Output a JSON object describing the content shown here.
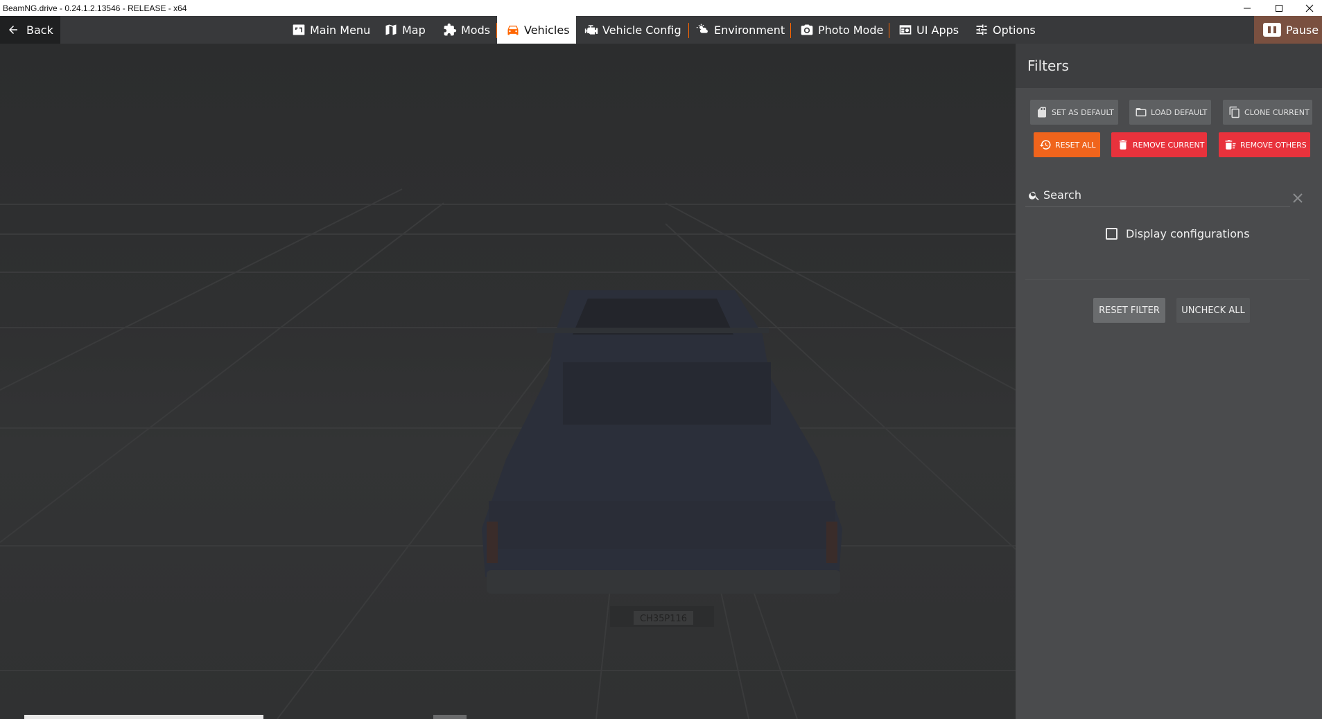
{
  "window": {
    "title": "BeamNG.drive - 0.24.1.2.13546 - RELEASE - x64"
  },
  "nav": {
    "back_label": "Back",
    "items": [
      {
        "label": "Main Menu",
        "icon": "main-menu-icon"
      },
      {
        "label": "Map",
        "icon": "map-icon"
      },
      {
        "label": "Mods",
        "icon": "puzzle-icon"
      },
      {
        "label": "Vehicles",
        "icon": "car-icon",
        "active": true
      },
      {
        "label": "Vehicle Config",
        "icon": "engine-icon"
      },
      {
        "label": "Environment",
        "icon": "weather-icon"
      },
      {
        "label": "Photo Mode",
        "icon": "camera-icon"
      },
      {
        "label": "UI Apps",
        "icon": "ui-apps-icon"
      },
      {
        "label": "Options",
        "icon": "sliders-icon"
      }
    ],
    "pause_label": "Pause"
  },
  "filters": {
    "title": "Filters",
    "buttons": {
      "set_default": "Set as default",
      "load_default": "Load default",
      "clone_current": "Clone current",
      "reset_all": "Reset all",
      "remove_current": "Remove current",
      "remove_others": "Remove others"
    },
    "search_placeholder": "Search",
    "display_configurations": {
      "label": "Display configurations",
      "checked": false
    },
    "reset_filter": "Reset filter",
    "uncheck_all": "Uncheck all"
  },
  "viewport": {
    "license_plate": "СН35Р116"
  },
  "colors": {
    "accent": "#ff6600",
    "orange_button": "#f0641c",
    "red_button": "#e8323c",
    "nav_bg": "#38393b",
    "panel_bg": "#4a4b4d"
  }
}
